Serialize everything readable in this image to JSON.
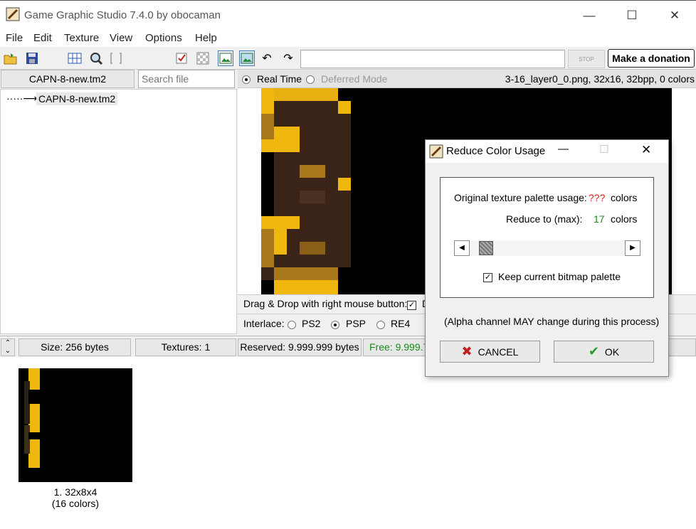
{
  "window": {
    "title": "Game Graphic Studio 7.4.0 by obocaman"
  },
  "menu": [
    "File",
    "Edit",
    "Texture",
    "View",
    "Options",
    "Help"
  ],
  "toolbar": {
    "stop_label": "STOP",
    "donate_label": "Make a donation",
    "path_value": ""
  },
  "left_panel": {
    "file_tab": "CAPN-8-new.tm2",
    "search_placeholder": "Search file",
    "tree_item": "CAPN-8-new.tm2"
  },
  "mode_bar": {
    "realtime_label": "Real Time",
    "deferred_label": "Deferred Mode",
    "file_info": "3-16_layer0_0.png, 32x16, 32bpp, 0 colors"
  },
  "drag_drop": {
    "label": "Drag & Drop with right mouse button:",
    "trailing": "D"
  },
  "interlace": {
    "label": "Interlace:",
    "options": [
      "PS2",
      "PSP",
      "RE4"
    ],
    "selected": "PSP"
  },
  "status": {
    "size": "Size: 256 bytes",
    "textures": "Textures: 1",
    "reserved": "Reserved: 9.999.999 bytes",
    "free": "Free: 9.999.7"
  },
  "thumbnail": {
    "caption_line1": "1. 32x8x4",
    "caption_line2": "(16 colors)"
  },
  "dialog": {
    "title": "Reduce Color Usage",
    "original_label": "Original texture palette usage:",
    "original_value": "???",
    "original_unit": "colors",
    "reduce_label": "Reduce to (max):",
    "reduce_value": "17",
    "reduce_unit": "colors",
    "keep_palette_label": "Keep current bitmap palette",
    "keep_palette_checked": true,
    "alpha_note": "(Alpha channel MAY change during this process)",
    "cancel_label": "CANCEL",
    "ok_label": "OK"
  },
  "colors": {
    "free_text": "#1a8a1a",
    "unknown_value": "#e02020",
    "reduce_value": "#1a8a1a",
    "brown": "#3a2418",
    "gold": "#f0b80e",
    "dark_gold": "#a8781a"
  }
}
